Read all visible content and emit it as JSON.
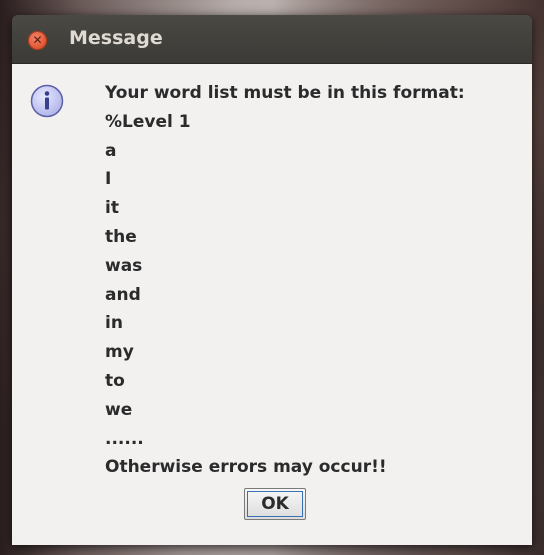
{
  "window": {
    "title": "Message"
  },
  "dialog": {
    "icon": "info-icon",
    "lines": [
      "Your word list must be in this format:",
      "%Level 1",
      "a",
      "I",
      "it",
      "the",
      "was",
      "and",
      "in",
      "my",
      "to",
      "we",
      "......",
      "Otherwise errors may occur!!"
    ],
    "ok_label": "OK"
  },
  "colors": {
    "titlebar": "#3b3a36",
    "close_button": "#e25a36",
    "content_bg": "#f2f1f0",
    "focus_ring": "#3c6eb4"
  }
}
